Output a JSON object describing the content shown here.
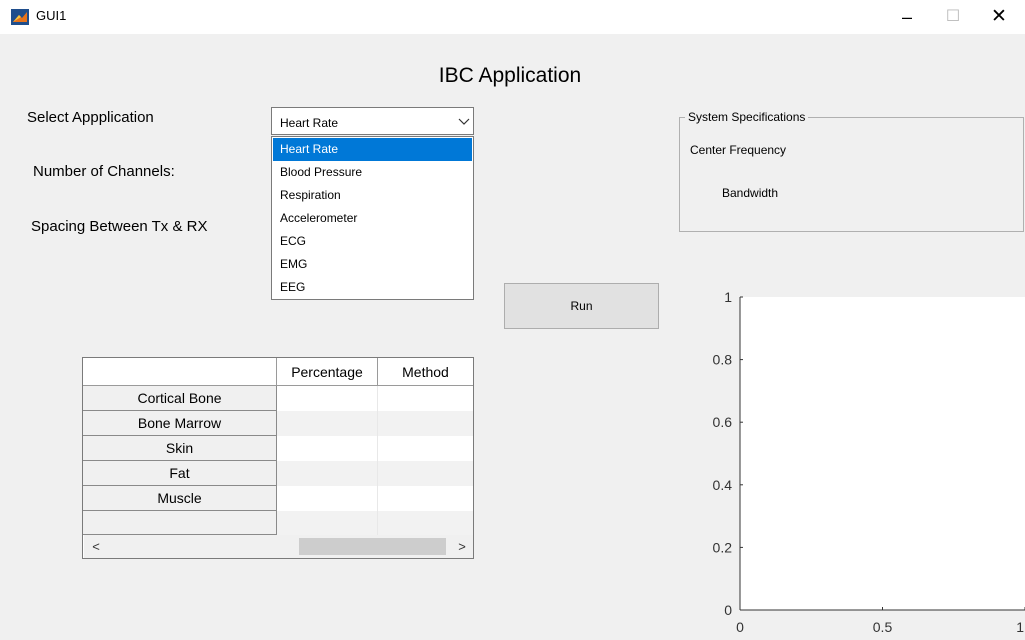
{
  "window": {
    "title": "GUI1",
    "controls": {
      "minimize": "–",
      "maximize": "☐",
      "close": "✕"
    }
  },
  "app_title": "IBC Application",
  "labels": {
    "select_application": "Select Appplication",
    "number_of_channels": "Number of Channels:",
    "spacing": "Spacing Between Tx & RX"
  },
  "dropdown": {
    "value": "Heart Rate",
    "options": [
      "Heart Rate",
      "Blood Pressure",
      "Respiration",
      "Accelerometer",
      "ECG",
      "EMG",
      "EEG"
    ],
    "selected_index": 0
  },
  "system_specs": {
    "title": "System Specifications",
    "center_frequency": "Center Frequency",
    "bandwidth": "Bandwidth"
  },
  "run_button": "Run",
  "table": {
    "columns": [
      "Percentage",
      "Method"
    ],
    "rows": [
      "Cortical Bone",
      "Bone Marrow",
      "Skin",
      "Fat",
      "Muscle",
      ""
    ],
    "scroll_left": "<",
    "scroll_right": ">"
  },
  "chart_data": {
    "type": "line",
    "series": [],
    "xlim": [
      0,
      1
    ],
    "ylim": [
      0,
      1
    ],
    "x_ticks": [
      "0",
      "0.5",
      "1"
    ],
    "y_ticks": [
      "0",
      "0.2",
      "0.4",
      "0.6",
      "0.8",
      "1"
    ],
    "title": "",
    "xlabel": "",
    "ylabel": "",
    "grid": false
  }
}
